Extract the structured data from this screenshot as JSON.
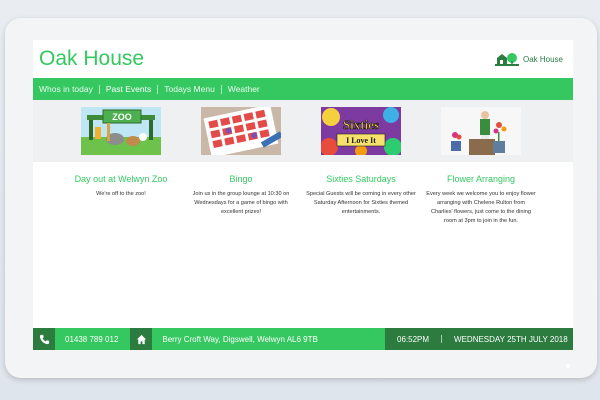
{
  "header": {
    "title": "Oak House",
    "logo_text": "Oak House"
  },
  "nav": {
    "items": [
      {
        "label": "Whos in today"
      },
      {
        "label": "Past Events"
      },
      {
        "label": "Todays Menu"
      },
      {
        "label": "Weather"
      }
    ],
    "active_index": 1
  },
  "thumbnails": {
    "zoo_sign": "ZOO",
    "sixties_line1": "Sixties",
    "sixties_line2": "I Love It"
  },
  "cards": [
    {
      "title": "Day out at Welwyn Zoo",
      "body": "We're off to the zoo!"
    },
    {
      "title": "Bingo",
      "body": "Join us in the group lounge at 10:30 on Wednesdays for a game of bingo with excellent prizes!"
    },
    {
      "title": "Sixties Saturdays",
      "body": "Special Guests will be coming in every other Saturday Afternoon for Sixties themed entertainments."
    },
    {
      "title": "Flower Arranging",
      "body": "Every week we welcome you to enjoy flower arranging with Chelene Rulton from Charlies' flowers, just come to the dining room at 3pm to join in the fun."
    }
  ],
  "footer": {
    "phone": "01438 789 012",
    "address": "Berry Croft Way, Digswell, Welwyn AL6 9TB",
    "time": "06:52PM",
    "date": "WEDNESDAY 25TH JULY 2018"
  },
  "colors": {
    "accent": "#35c861",
    "dark_accent": "#2c7b3f",
    "strip_bg": "#eef0f2"
  },
  "icons": [
    "house-tree-logo-icon",
    "phone-icon",
    "home-icon"
  ]
}
